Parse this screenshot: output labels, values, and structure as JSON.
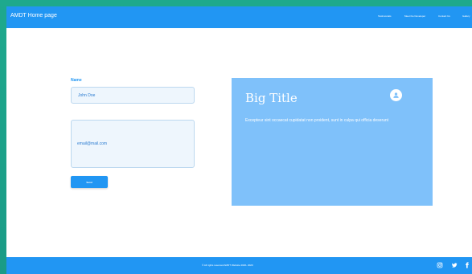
{
  "header": {
    "brand": "AMDT Home page",
    "nav": [
      "Testimonials",
      "Meet the Developer",
      "Contact Us",
      "Gallery"
    ]
  },
  "form": {
    "label": "Name",
    "name_value": "John Doe",
    "email_value": "email@mail.com",
    "send_label": "Send"
  },
  "card": {
    "title": "Big Title",
    "text": "Excepteur sint occaecat cupidatat non proident, sunt in culpa qui officia deserunt"
  },
  "footer": {
    "copyright": "© All rights reserved AMDT Website 2020- 2020"
  },
  "icons": {
    "avatar": "user-icon",
    "social": [
      "instagram-icon",
      "twitter-icon",
      "facebook-icon"
    ]
  },
  "colors": {
    "primary": "#2196f3",
    "card": "#7fc1fa",
    "frame": "#1fa38a"
  }
}
